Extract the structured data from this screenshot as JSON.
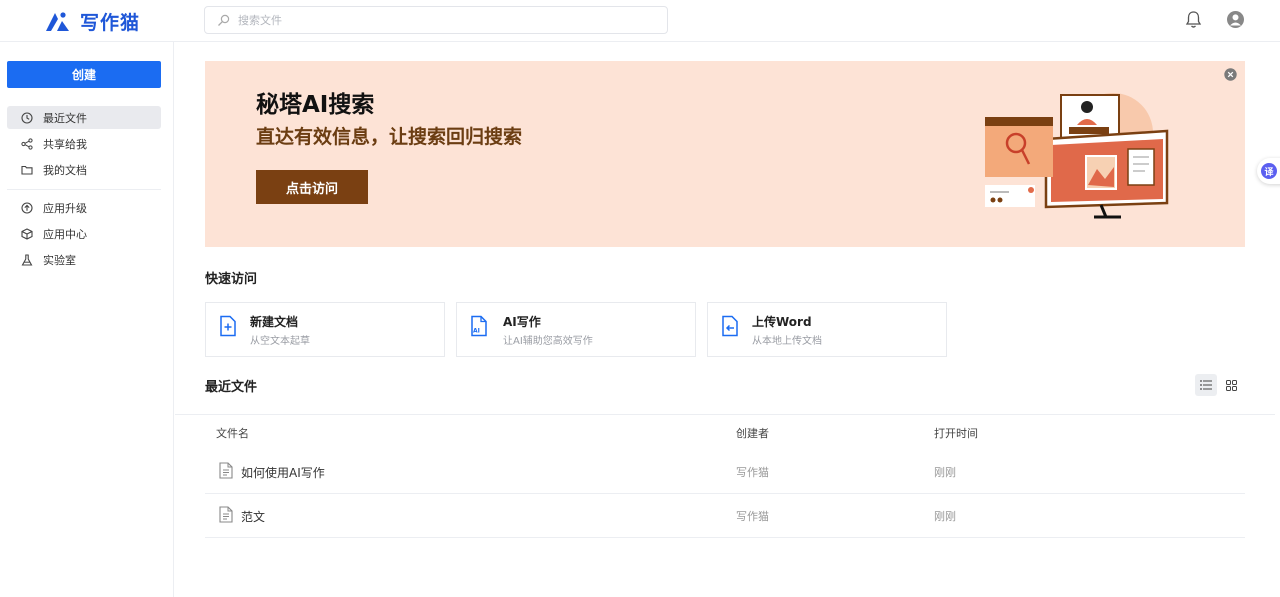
{
  "app": {
    "name": "写作猫"
  },
  "search": {
    "placeholder": "搜索文件"
  },
  "sidebar": {
    "create_label": "创建",
    "items": [
      {
        "label": "最近文件",
        "icon": "clock-icon",
        "active": true
      },
      {
        "label": "共享给我",
        "icon": "share-icon",
        "active": false
      },
      {
        "label": "我的文档",
        "icon": "folder-icon",
        "active": false
      },
      {
        "label": "应用升级",
        "icon": "upgrade-icon",
        "active": false
      },
      {
        "label": "应用中心",
        "icon": "cube-icon",
        "active": false
      },
      {
        "label": "实验室",
        "icon": "flask-icon",
        "active": false
      }
    ]
  },
  "banner": {
    "title": "秘塔AI搜索",
    "subtitle": "直达有效信息，让搜索回归搜索",
    "button_label": "点击访问"
  },
  "quick_access": {
    "title": "快速访问",
    "cards": [
      {
        "title": "新建文档",
        "desc": "从空文本起草",
        "icon": "new-doc-icon"
      },
      {
        "title": "AI写作",
        "desc": "让AI辅助您高效写作",
        "icon": "ai-doc-icon"
      },
      {
        "title": "上传Word",
        "desc": "从本地上传文档",
        "icon": "upload-doc-icon"
      }
    ]
  },
  "recent": {
    "title": "最近文件",
    "columns": [
      "文件名",
      "创建者",
      "打开时间"
    ],
    "rows": [
      {
        "name": "如何使用AI写作",
        "creator": "写作猫",
        "time": "刚刚"
      },
      {
        "name": "范文",
        "creator": "写作猫",
        "time": "刚刚"
      }
    ]
  },
  "translate_fab": {
    "label": "译"
  },
  "colors": {
    "accent": "#1b6cf2",
    "banner_bg": "#fde3d6",
    "banner_button": "#7a4012",
    "brand": "#1f57d8"
  }
}
